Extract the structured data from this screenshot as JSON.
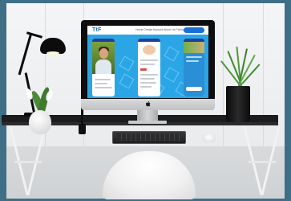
{
  "scene": {
    "description_objects": [
      "desk-lamp",
      "potted-plant-left",
      "imac",
      "pen-holder",
      "keyboard",
      "mouse",
      "potted-plant-right",
      "chair"
    ],
    "colors": {
      "frame": "#3f6f86",
      "screen_bg": "#2aa6e7",
      "desk": "#1c1c1e"
    }
  },
  "screen": {
    "logo_text": "TtF",
    "menu_text": "Home  Create Account  About Us  Pricing",
    "cta_label": ""
  }
}
